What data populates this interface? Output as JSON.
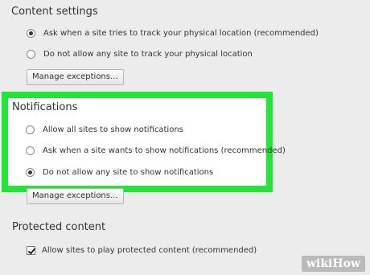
{
  "content_settings": {
    "title": "Content settings",
    "location_options": [
      {
        "label": "Ask when a site tries to track your physical location (recommended)",
        "checked": true
      },
      {
        "label": "Do not allow any site to track your physical location",
        "checked": false
      }
    ],
    "manage_exceptions_label": "Manage exceptions..."
  },
  "notifications": {
    "title": "Notifications",
    "options": [
      {
        "label": "Allow all sites to show notifications",
        "checked": false
      },
      {
        "label": "Ask when a site wants to show notifications (recommended)",
        "checked": false
      },
      {
        "label": "Do not allow any site to show notifications",
        "checked": true
      }
    ],
    "manage_exceptions_label": "Manage exceptions...",
    "highlight_color": "#22e635"
  },
  "protected_content": {
    "title": "Protected content",
    "checkbox_label": "Allow sites to play protected content (recommended)",
    "checked": true
  },
  "watermark": {
    "text": "wikiHow"
  }
}
